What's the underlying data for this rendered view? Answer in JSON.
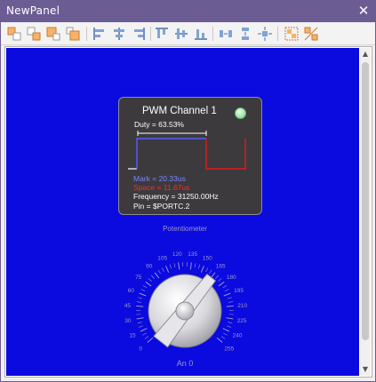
{
  "window": {
    "title": "NewPanel",
    "close_glyph": "✕"
  },
  "toolbar": {
    "buttons": [
      "bring-to-front-icon",
      "send-to-back-icon",
      "bring-forward-icon",
      "send-backward-icon",
      "align-left-icon",
      "align-center-icon",
      "align-right-icon",
      "align-top-icon",
      "align-middle-icon",
      "align-bottom-icon",
      "space-horizontal-icon",
      "space-vertical-icon",
      "center-in-panel-icon",
      "group-icon",
      "ungroup-icon"
    ]
  },
  "pwm": {
    "title": "PWM Channel 1",
    "duty": "Duty = 63.53%",
    "mark": "Mark = 20.33us",
    "space": "Space = 11.67us",
    "frequency": "Frequency = 31250.00Hz",
    "pin": "Pin = $PORTC.2",
    "duty_fraction": 0.6353,
    "colors": {
      "mark": "#5a5cff",
      "space": "#e11a1a",
      "led": "#9fe5a8"
    }
  },
  "potentiometer": {
    "title": "Potentiometer",
    "channel": "An 0",
    "scale_labels": [
      "0",
      "15",
      "30",
      "45",
      "60",
      "75",
      "90",
      "105",
      "120",
      "135",
      "150",
      "165",
      "180",
      "195",
      "210",
      "225",
      "240",
      "255"
    ],
    "value": 165,
    "min": 0,
    "max": 255
  },
  "colors": {
    "titlebar": "#6b5d93",
    "canvas": "#0b0adf"
  }
}
